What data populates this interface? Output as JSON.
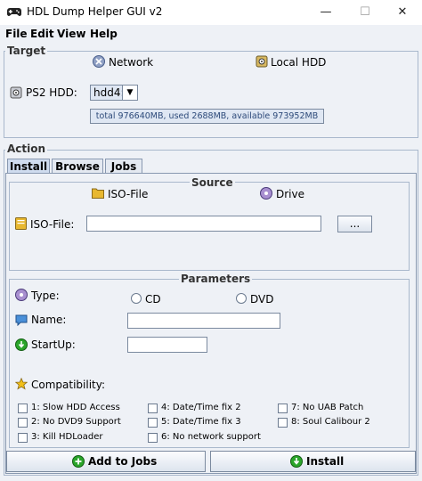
{
  "window": {
    "title": "HDL Dump Helper GUI v2",
    "minimize_glyph": "—",
    "maximize_glyph": "☐",
    "close_glyph": "✕"
  },
  "menu": [
    "File",
    "Edit",
    "View",
    "Help"
  ],
  "target": {
    "group_label": "Target",
    "network_label": "Network",
    "local_hdd_label": "Local HDD",
    "ps2_hdd_label": "PS2 HDD:",
    "hdd_selected": "hdd4:",
    "hdd_info": "total 976640MB, used 2688MB, available 973952MB"
  },
  "action": {
    "group_label": "Action",
    "tabs": [
      "Install",
      "Browse",
      "Jobs"
    ],
    "active_tab": "Install"
  },
  "source": {
    "group_label": "Source",
    "iso_file_radio": "ISO-File",
    "drive_radio": "Drive",
    "iso_file_label": "ISO-File:",
    "iso_file_value": "",
    "browse_button": "..."
  },
  "parameters": {
    "group_label": "Parameters",
    "type_label": "Type:",
    "cd_label": "CD",
    "dvd_label": "DVD",
    "name_label": "Name:",
    "name_value": "",
    "startup_label": "StartUp:",
    "startup_value": "",
    "compatibility_label": "Compatibility:",
    "compat_options": [
      "1: Slow HDD Access",
      "2: No DVD9 Support",
      "3: Kill HDLoader",
      "4: Date/Time fix 2",
      "5: Date/Time fix 3",
      "6: No network support",
      "7: No UAB Patch",
      "8: Soul Calibour 2"
    ]
  },
  "buttons": {
    "add_to_jobs": "Add to Jobs",
    "install": "Install"
  },
  "colors": {
    "accent": "#2d4a7a",
    "green_icon": "#2aa52a",
    "folder": "#e8b830"
  }
}
